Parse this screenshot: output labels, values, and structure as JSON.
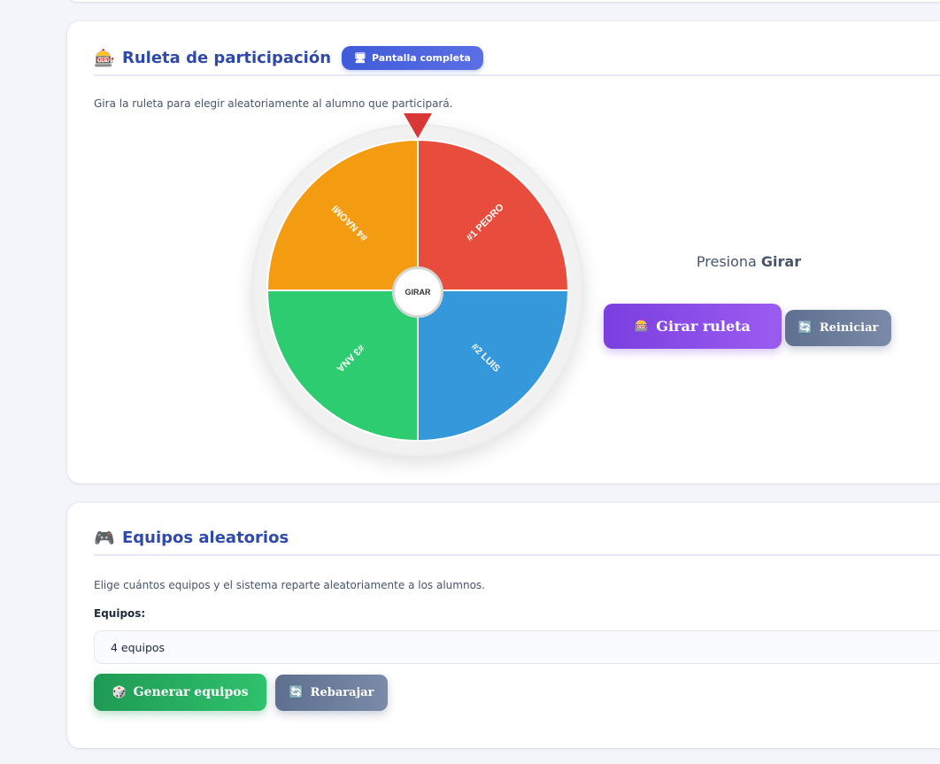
{
  "ruleta": {
    "icon": "slot-machine-icon",
    "title": "Ruleta de participación",
    "fullscreen_label": "Pantalla completa",
    "fullscreen_icon": "monitor-icon",
    "description": "Gira la ruleta para elegir aleatoriamente al alumno que participará.",
    "hub_label": "GIRAR",
    "status_prefix": "Presiona",
    "status_bold": "Girar",
    "spin_label": "Girar ruleta",
    "spin_icon": "slot-machine-icon",
    "reset_label": "Reiniciar",
    "reset_icon": "refresh-icon",
    "pointer_color": "#d93636",
    "segments": [
      {
        "label": "#1 PEDRO",
        "color": "#e74c3c"
      },
      {
        "label": "#2 LUIS",
        "color": "#3498db"
      },
      {
        "label": "#3 ANA",
        "color": "#2ecc71"
      },
      {
        "label": "#4 NAOMI",
        "color": "#f39c12"
      }
    ]
  },
  "equipos": {
    "icon": "gamepad-icon",
    "title": "Equipos aleatorios",
    "description": "Elige cuántos equipos y el sistema reparte aleatoriamente a los alumnos.",
    "teams_label": "Equipos:",
    "teams_value": "4 equipos",
    "generate_label": "Generar equipos",
    "generate_icon": "dice-icon",
    "reshuffle_label": "Rebarajar",
    "reshuffle_icon": "refresh-icon"
  }
}
